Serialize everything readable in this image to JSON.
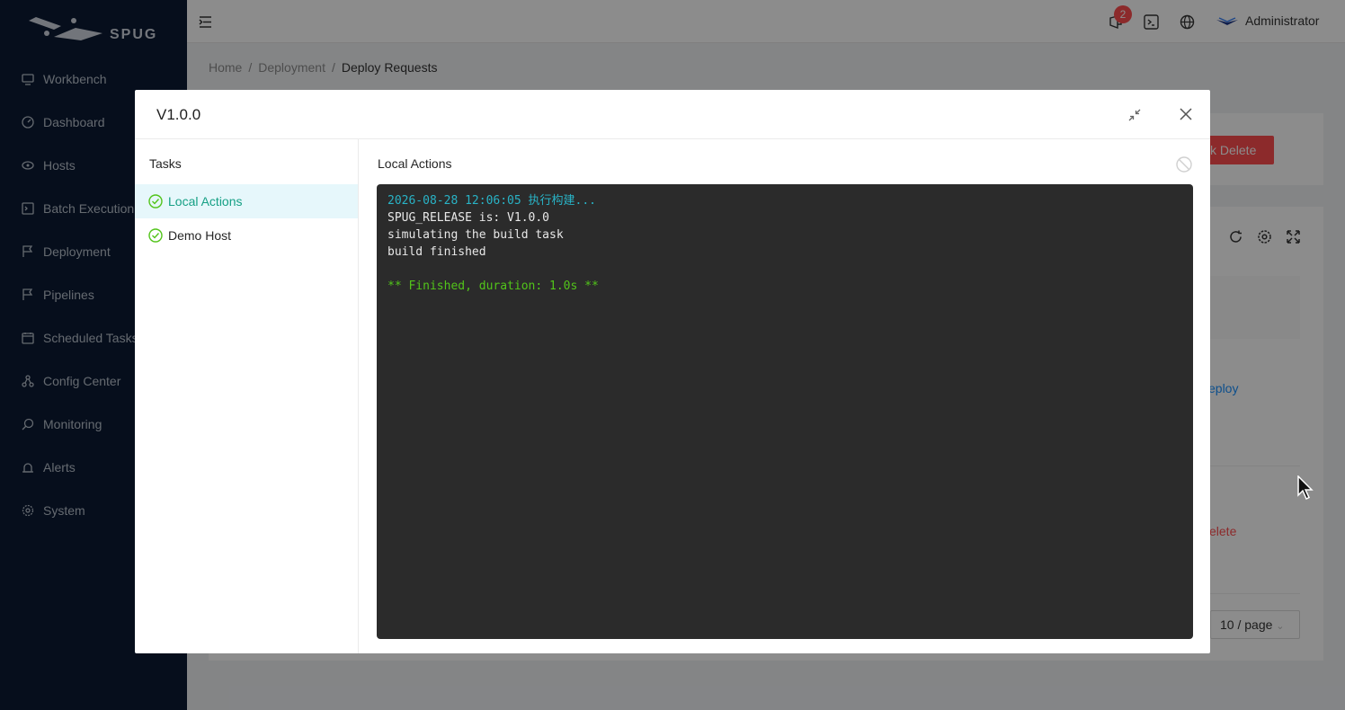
{
  "app": {
    "logo_text": "SPUG"
  },
  "sidebar": {
    "items": [
      {
        "label": "Workbench",
        "icon": "monitor-icon"
      },
      {
        "label": "Dashboard",
        "icon": "dashboard-icon"
      },
      {
        "label": "Hosts",
        "icon": "cloud-server-icon"
      },
      {
        "label": "Batch Execution",
        "icon": "terminal-icon"
      },
      {
        "label": "Deployment",
        "icon": "flag-icon"
      },
      {
        "label": "Pipelines",
        "icon": "pipeline-flag-icon"
      },
      {
        "label": "Scheduled Tasks",
        "icon": "calendar-icon"
      },
      {
        "label": "Config Center",
        "icon": "deployment-unit-icon"
      },
      {
        "label": "Monitoring",
        "icon": "search-monitor-icon"
      },
      {
        "label": "Alerts",
        "icon": "alarm-icon"
      },
      {
        "label": "System",
        "icon": "gear-icon"
      }
    ]
  },
  "header": {
    "notification_count": "2",
    "user_name": "Administrator"
  },
  "breadcrumb": {
    "home": "Home",
    "section": "Deployment",
    "current": "Deploy Requests"
  },
  "background": {
    "batch_delete_label": "k Delete",
    "deploy_link": "eploy",
    "delete_link": "elete",
    "page_size": "10 / page"
  },
  "modal": {
    "title": "V1.0.0",
    "tasks_title": "Tasks",
    "tasks": [
      {
        "label": "Local Actions",
        "status": "success"
      },
      {
        "label": "Demo Host",
        "status": "success"
      }
    ],
    "panel_title": "Local Actions",
    "console_lines": [
      "2026-08-28 12:06:05 执行构建...",
      "SPUG_RELEASE is: V1.0.0",
      "simulating the build task",
      "build finished",
      "",
      "** Finished, duration: 1.0s **"
    ]
  },
  "colors": {
    "sidebar_bg": "#0b1a33",
    "accent": "#16a085",
    "danger": "#ff4d4f",
    "console_bg": "#2b2b2b",
    "console_info": "#29b3c6",
    "console_success": "#52c41a"
  }
}
